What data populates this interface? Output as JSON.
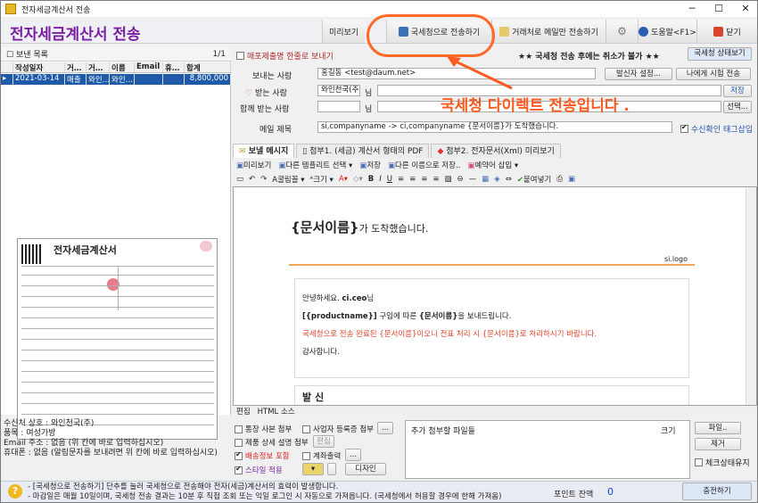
{
  "window": {
    "title": "전자세금계산서 전송",
    "minimize": "─",
    "maximize": "☐",
    "close": "✕"
  },
  "app": {
    "title": "전자세금계산서 전송"
  },
  "toolbar": {
    "preview": "미리보기",
    "send_nts": "국세청으로 전송하기",
    "email_only": "거래처로 메일만 전송하기",
    "help": "도움말<F1>",
    "close": "닫기"
  },
  "left": {
    "header": "보낸 목록",
    "page": "1/1",
    "columns": [
      "작성일자",
      "거…",
      "거…",
      "이름",
      "Email",
      "휴…",
      "합계"
    ],
    "row": [
      "2021-03-14",
      "매출",
      "와인…",
      "와인…",
      "",
      "",
      "8,800,000"
    ]
  },
  "invoice": {
    "title": "전자세금계산서"
  },
  "leftinfo": [
    "수신처 상호 : 와인천국(주)",
    "품목 : 여성가방",
    "Email 주소 : 없음 (위 칸에 바로 입력하십시오)",
    "휴대폰 : 없음 (알림문자를 보내려면 위 칸에 바로 입력하십시오)"
  ],
  "form": {
    "view_alt": "매포제출명 한줄로 보내기",
    "notice": "★★ 국세청 전송 후에는 취소가 불가 ★★",
    "status_btn": "국세청 상태보기",
    "sender_label": "보내는 사람",
    "sender_value": "홍길동 <test@daum.net>",
    "sender_btn": "발신자 설정...",
    "test_btn": "나에게 시험 전송",
    "recv_label": "받는 사람",
    "recv_value": "와인천국(주)",
    "recv_suffix": "님",
    "save_btn": "저장",
    "cc_label": "함께 받는 사람",
    "cc_suffix": "님",
    "select_btn": "선택...",
    "subject_label": "메일 제목",
    "subject_value": "si,companyname -> ci,companyname {문서이름}가 도착했습니다.",
    "receipt_tag": "수신확인 태그삽입"
  },
  "annotation": "국세청 다이렉트 전송입니다 .",
  "tabs": [
    "보낼 메시지",
    "첨부1. (세금) 계산서 형태의 PDF",
    "첨부2. 전자문서(Xml) 미리보기"
  ],
  "tb1": [
    "미리보기",
    "다른 템플리트 선택 ▾",
    "저장",
    "다른 이름으로 저장..",
    "예약어 삽입 ▾"
  ],
  "tb2": {
    "font": "굴림꼴 ▾",
    "size": "크기 ▾",
    "paste": "붙여넣기"
  },
  "editor": {
    "title": "{문서이름}",
    "title_suffix": "가 도착했습니다.",
    "logo": "si.logo",
    "greet_prefix": "안녕하세요. ",
    "greet_name": "ci.ceo",
    "greet_suffix": "님",
    "line2_prefix": "[{productname}]",
    "line2_mid": " 구입에 따른 ",
    "line2_doc": "{문서이름}",
    "line2_suffix": "을 보내드립니다.",
    "line3": "국세청으로 전송 완료된 {문서이름}이오니 전표 처리 시 {문서이름}로 처리하시기 바랍니다.",
    "thanks": "감사합니다.",
    "sender_heading": "발 신"
  },
  "ed_tabs": [
    "편집",
    "HTML 소스"
  ],
  "options": {
    "opt1": "통장 사본 첨부",
    "opt2": "사업자 등록증 첨부",
    "opt3": "제품 상세 설명 첨부",
    "opt3_btn": "편집",
    "opt4": "배송정보 포함",
    "opt5": "계좌출력",
    "opt6": "스타일 적용",
    "design_btn": "디자인"
  },
  "attach": {
    "col_name": "추가 첨부할 파일들",
    "col_size": "크기",
    "file_btn": "파일..",
    "remove_btn": "제거",
    "check_status": "체크상태유지"
  },
  "footer": {
    "line1": "- [국세청으로 전송하기] 단추를 눌러 국세청으로 전송해야 전자(세금)계산서의 효력이 발생합니다.",
    "line2": "- 마감일은 매월 10일이며, 국세청 전송 결과는 10분 후 직접 조회 또는 익일 로그인 시 자동으로 가져옵니다. (국세청에서 허용할 경우에 한해 가져옴)",
    "points_label": "포인트 잔액",
    "points": "0",
    "charge_btn": "충전하기"
  },
  "colors": {
    "brand": "#7a1fa2",
    "accent": "#ff5a1f",
    "highlight": "#ff6a2b",
    "selected_row": "#1e5aa8",
    "warn_text": "#e0452b"
  }
}
